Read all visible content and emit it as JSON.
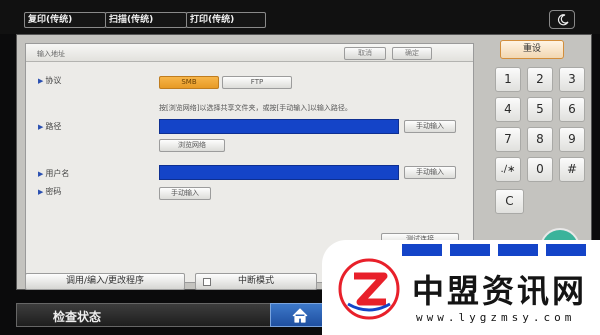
{
  "top_tabs": [
    {
      "label": "复印(传统)"
    },
    {
      "label": "扫描(传统)"
    },
    {
      "label": "打印(传统)"
    }
  ],
  "icons": {
    "theme": "moon-icon",
    "home": "home-icon",
    "scroll": "scroll-up-icon",
    "brand": "brand-logo-icon"
  },
  "panel": {
    "title": "输入地址",
    "cancel_label": "取消",
    "confirm_label": "确定",
    "protocol": {
      "label": "协议",
      "options": [
        "SMB",
        "FTP"
      ],
      "selected": "SMB"
    },
    "path": {
      "hint": "按[浏览网络]以选择共享文件夹，或按[手动输入]以输入路径。",
      "label": "路径",
      "value": "",
      "manual_label": "手动输入",
      "browse_label": "浏览网络"
    },
    "username": {
      "label": "用户名",
      "value": "",
      "manual_label": "手动输入"
    },
    "password": {
      "label": "密码",
      "manual_label": "手动输入"
    },
    "test_connection_label": "测试连接"
  },
  "keypad": {
    "reset_label": "重设",
    "keys": [
      "1",
      "2",
      "3",
      "4",
      "5",
      "6",
      "7",
      "8",
      "9",
      ".∕∗",
      "0",
      "#"
    ],
    "clear_label": "C"
  },
  "bottom_bar": {
    "program_label": "调用/编入/更改程序",
    "interrupt_label": "中断模式"
  },
  "status": {
    "label": "检查状态"
  },
  "brand": {
    "name": "中盟资讯网",
    "url": "www.lygzmsy.com",
    "colors": {
      "accent": "#e8202a",
      "teal": "#3bb39b",
      "blue": "#1444c8",
      "orange": "#f0a637"
    }
  }
}
